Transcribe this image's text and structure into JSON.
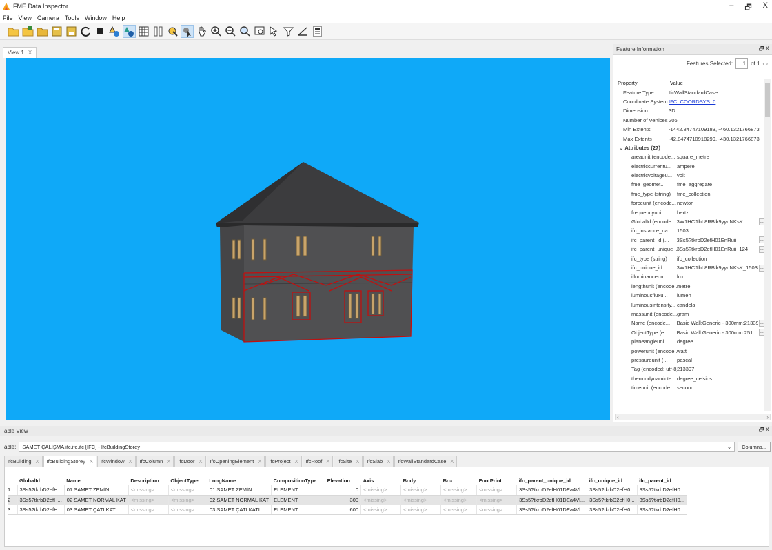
{
  "window": {
    "title": "FME Data Inspector",
    "buttons": [
      "–",
      "🗗",
      "X"
    ]
  },
  "menu": [
    "File",
    "View",
    "Camera",
    "Tools",
    "Window",
    "Help"
  ],
  "view": {
    "tab_label": "View 1",
    "tab_close": "X"
  },
  "info": {
    "header": "Feature Information",
    "header_controls": "🗗 X",
    "features_selected_label": "Features Selected:",
    "features_selected_value": "1",
    "features_total": "of 1",
    "nav": "‹ ›",
    "columns": [
      "Property",
      "Value"
    ],
    "properties": [
      {
        "k": "Feature Type",
        "v": "IfcWallStandardCase"
      },
      {
        "k": "Coordinate System",
        "v": "IFC_COORDSYS_0",
        "link": true
      },
      {
        "k": "Dimension",
        "v": "3D"
      },
      {
        "k": "Number of Vertices",
        "v": "206"
      },
      {
        "k": "Min Extents",
        "v": "-1442.84747109183, -460.1321766873..."
      },
      {
        "k": "Max Extents",
        "v": "-42.8474710918299, -430.1321766873..."
      }
    ],
    "attributes_group": "Attributes (27)",
    "attributes": [
      {
        "k": "areaunit (encode...",
        "v": "square_metre"
      },
      {
        "k": "electriccurrentu...",
        "v": "ampere"
      },
      {
        "k": "electricvoltageu...",
        "v": "volt"
      },
      {
        "k": "fme_geomet...",
        "v": "fme_aggregate"
      },
      {
        "k": "fme_type (string)",
        "v": "fme_collection"
      },
      {
        "k": "forceunit (encode...",
        "v": "newton"
      },
      {
        "k": "frequencyunit...",
        "v": "hertz"
      },
      {
        "k": "GlobalId (encode...",
        "v": "3W1HCJlhL8RBlk9yyuNKsK",
        "more": true
      },
      {
        "k": "ifc_instance_na...",
        "v": "1503"
      },
      {
        "k": "ifc_parent_id (...",
        "v": "3Ss5?tkrbD2efH01EnRuii",
        "more": true
      },
      {
        "k": "ifc_parent_unique_...",
        "v": "3Ss5?tkrbD2efH01EnRuii_124",
        "more": true
      },
      {
        "k": "ifc_type (string)",
        "v": "ifc_collection"
      },
      {
        "k": "ifc_unique_id ...",
        "v": "3W1HCJlhL8RBlk9yyuNKsK_1503",
        "more": true
      },
      {
        "k": "illuminanceun...",
        "v": "lux"
      },
      {
        "k": "lengthunit (encode...",
        "v": "metre"
      },
      {
        "k": "luminousfluxu...",
        "v": "lumen"
      },
      {
        "k": "luminousintensity...",
        "v": "candela"
      },
      {
        "k": "massunit (encode...",
        "v": "gram"
      },
      {
        "k": "Name (encode...",
        "v": "Basic Wall:Generic - 300mm:213397",
        "more": true
      },
      {
        "k": "ObjectType (e...",
        "v": "Basic Wall:Generic - 300mm:251",
        "more": true
      },
      {
        "k": "planeangleuni...",
        "v": "degree"
      },
      {
        "k": "powerunit (encode...",
        "v": "watt"
      },
      {
        "k": "pressureunit (...",
        "v": "pascal"
      },
      {
        "k": "Tag (encoded: utf-8)",
        "v": "213397"
      },
      {
        "k": "thermodynamicte...",
        "v": "degree_celsius"
      },
      {
        "k": "timeunit (encode...",
        "v": "second"
      }
    ]
  },
  "tableview": {
    "header": "Table View",
    "header_controls": "🗗 X",
    "table_label": "Table:",
    "table_value": "SAMET ÇALIŞMA.ifc.ifc.ifc [IFC] - IfcBuildingStorey",
    "columns_button": "Columns...",
    "tabs": [
      "IfcBuilding",
      "IfcBuildingStorey",
      "IfcWindow",
      "IfcColumn",
      "IfcDoor",
      "IfcOpeningElement",
      "IfcProject",
      "IfcRoof",
      "IfcSite",
      "IfcSlab",
      "IfcWallStandardCase"
    ],
    "active_tab": 1,
    "headers": [
      "GlobalId",
      "Name",
      "Description",
      "ObjectType",
      "LongName",
      "CompositionType",
      "Elevation",
      "Axis",
      "Body",
      "Box",
      "FootPrint",
      "ifc_parent_unique_id",
      "ifc_unique_id",
      "ifc_parent_id"
    ],
    "rows": [
      [
        "1",
        "3Ss5?tkrbD2efH...",
        "01 SAMET ZEMİN",
        "<missing>",
        "<missing>",
        "01 SAMET ZEMİN",
        "ELEMENT",
        "0",
        "<missing>",
        "<missing>",
        "<missing>",
        "<missing>",
        "3Ss5?tkrbD2efH01DEa4Vl...",
        "3Ss5?tkrbD2efH0...",
        "3Ss5?tkrbD2efH0..."
      ],
      [
        "2",
        "3Ss5?tkrbD2efH...",
        "02 SAMET NORMAL KAT",
        "<missing>",
        "<missing>",
        "02 SAMET NORMAL KAT",
        "ELEMENT",
        "300",
        "<missing>",
        "<missing>",
        "<missing>",
        "<missing>",
        "3Ss5?tkrbD2efH01DEa4Vl...",
        "3Ss5?tkrbD2efH0...",
        "3Ss5?tkrbD2efH0..."
      ],
      [
        "3",
        "3Ss5?tkrbD2efH...",
        "03 SAMET ÇATI KATI",
        "<missing>",
        "<missing>",
        "03 SAMET ÇATI KATI",
        "ELEMENT",
        "600",
        "<missing>",
        "<missing>",
        "<missing>",
        "<missing>",
        "3Ss5?tkrbD2efH01DEa4Vl...",
        "3Ss5?tkrbD2efH0...",
        "3Ss5?tkrbD2efH0..."
      ]
    ]
  },
  "colors": {
    "viewport_bg": "#0fa9f8",
    "roof": "#3a3a3c",
    "wall": "#4a4a4c",
    "selection": "#c01010",
    "window": "#c9a46a"
  }
}
